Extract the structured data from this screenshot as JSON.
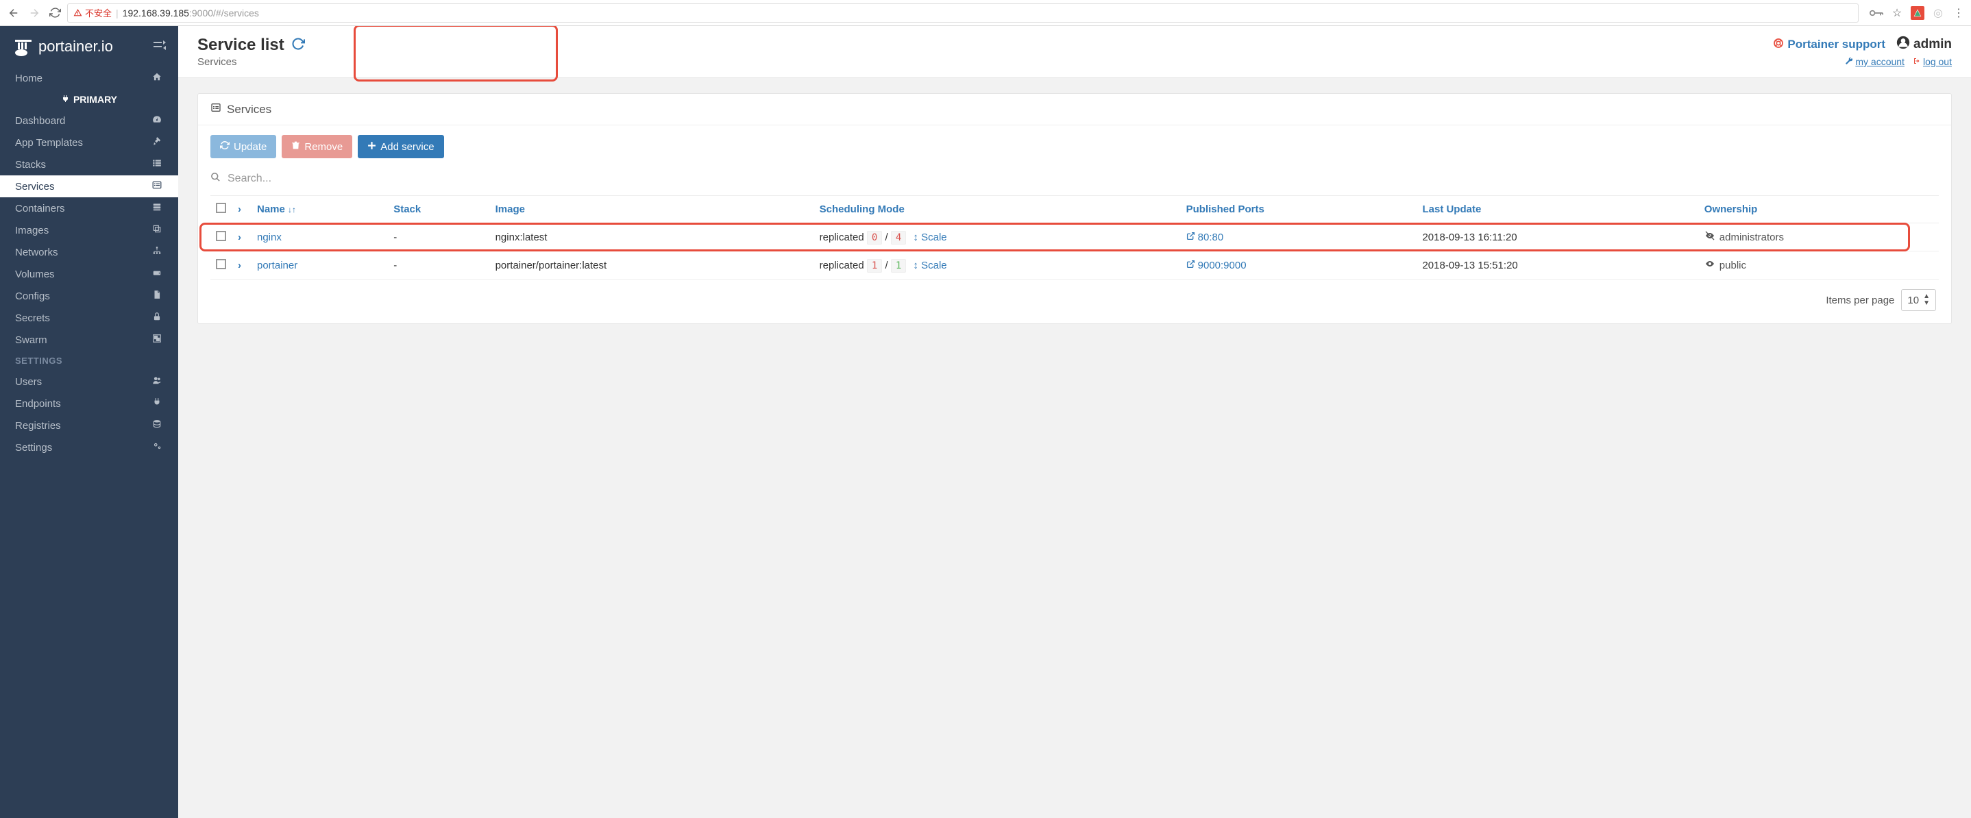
{
  "browser": {
    "insecure_label": "不安全",
    "url_host": "192.168.39.185",
    "url_port_path": ":9000/#/services"
  },
  "sidebar": {
    "brand": "portainer.io",
    "home": "Home",
    "primary": "PRIMARY",
    "items": [
      {
        "label": "Dashboard",
        "icon": "tachometer"
      },
      {
        "label": "App Templates",
        "icon": "rocket"
      },
      {
        "label": "Stacks",
        "icon": "th-list"
      },
      {
        "label": "Services",
        "icon": "list-alt",
        "active": true
      },
      {
        "label": "Containers",
        "icon": "server"
      },
      {
        "label": "Images",
        "icon": "clone"
      },
      {
        "label": "Networks",
        "icon": "sitemap"
      },
      {
        "label": "Volumes",
        "icon": "hdd"
      },
      {
        "label": "Configs",
        "icon": "file"
      },
      {
        "label": "Secrets",
        "icon": "lock"
      },
      {
        "label": "Swarm",
        "icon": "object-group"
      }
    ],
    "settings_heading": "SETTINGS",
    "settings_items": [
      {
        "label": "Users",
        "icon": "users"
      },
      {
        "label": "Endpoints",
        "icon": "plug"
      },
      {
        "label": "Registries",
        "icon": "database"
      },
      {
        "label": "Settings",
        "icon": "cogs"
      }
    ]
  },
  "header": {
    "title": "Service list",
    "subtitle": "Services",
    "support": "Portainer support",
    "user": "admin",
    "my_account": "my account",
    "log_out": "log out"
  },
  "panel": {
    "title": "Services",
    "update_btn": "Update",
    "remove_btn": "Remove",
    "add_btn": "Add service",
    "search_placeholder": "Search...",
    "columns": {
      "name": "Name",
      "stack": "Stack",
      "image": "Image",
      "scheduling": "Scheduling Mode",
      "ports": "Published Ports",
      "updated": "Last Update",
      "ownership": "Ownership"
    },
    "rows": [
      {
        "name": "nginx",
        "stack": "-",
        "image": "nginx:latest",
        "mode": "replicated",
        "running": "0",
        "desired": "4",
        "scale": "Scale",
        "port": "80:80",
        "updated": "2018-09-13 16:11:20",
        "owner_icon": "eye-slash",
        "owner": "administrators"
      },
      {
        "name": "portainer",
        "stack": "-",
        "image": "portainer/portainer:latest",
        "mode": "replicated",
        "running": "1",
        "desired": "1",
        "scale": "Scale",
        "port": "9000:9000",
        "updated": "2018-09-13 15:51:20",
        "owner_icon": "eye",
        "owner": "public"
      }
    ],
    "items_per_page": "Items per page",
    "page_size": "10"
  }
}
